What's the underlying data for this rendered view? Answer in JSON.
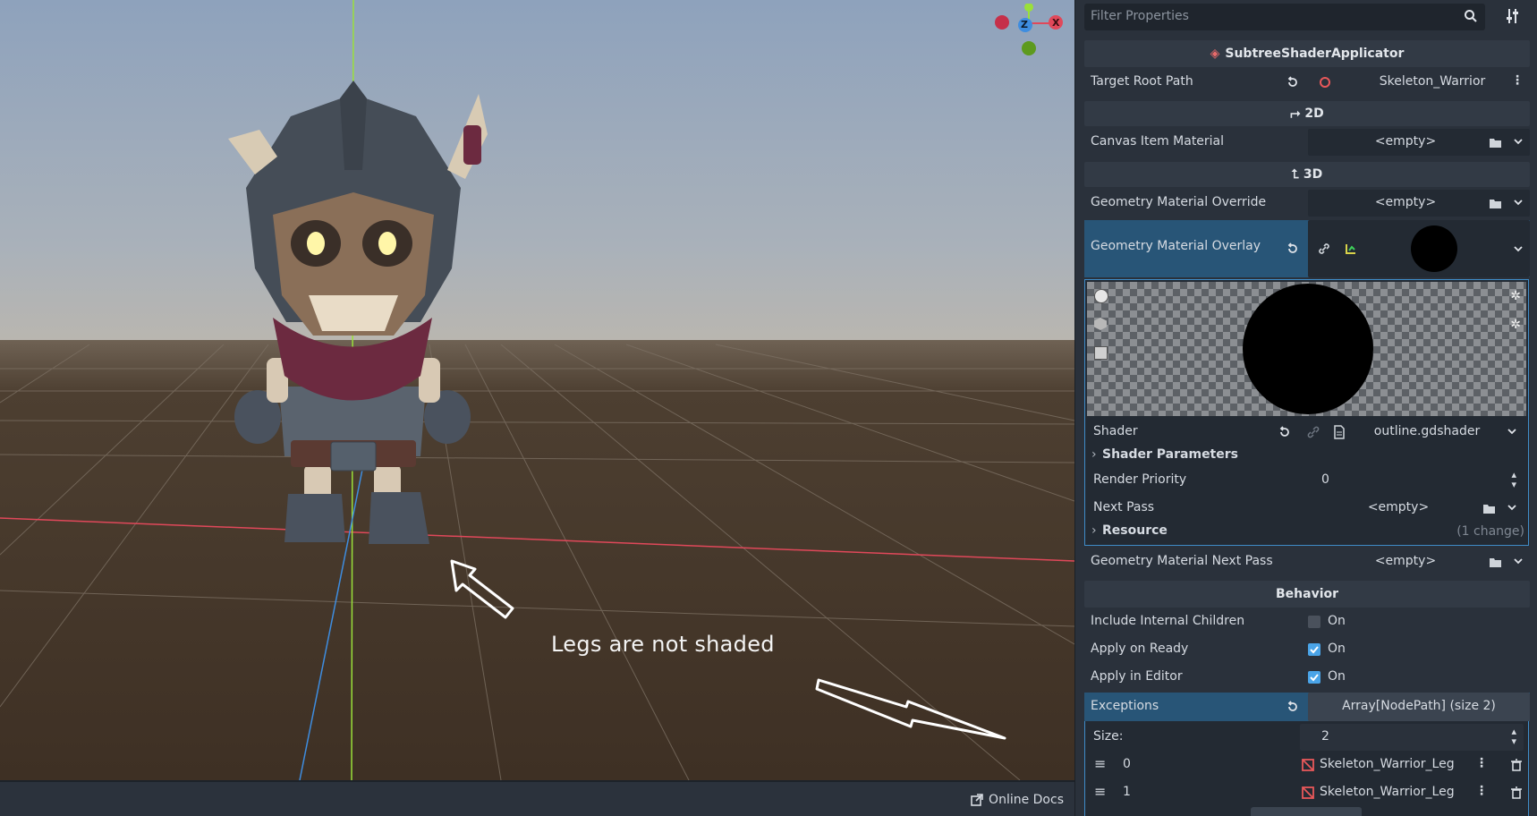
{
  "viewport": {
    "annotation": "Legs are not shaded",
    "gizmo": {
      "z_label": "Z",
      "x_label": "X"
    }
  },
  "bottom_bar": {
    "online_docs": "Online Docs"
  },
  "inspector": {
    "filter_placeholder": "Filter Properties",
    "node_section": "SubtreeShaderApplicator",
    "target_root_path": {
      "label": "Target Root Path",
      "value": "Skeleton_Warrior"
    },
    "section_2d": "2D",
    "canvas_item_material": {
      "label": "Canvas Item Material",
      "value": "<empty>"
    },
    "section_3d": "3D",
    "geometry_material_override": {
      "label": "Geometry Material Override",
      "value": "<empty>"
    },
    "geometry_material_overlay": {
      "label": "Geometry Material Overlay"
    },
    "shader": {
      "label": "Shader",
      "value": "outline.gdshader"
    },
    "shader_parameters": "Shader Parameters",
    "render_priority": {
      "label": "Render Priority",
      "value": "0"
    },
    "next_pass": {
      "label": "Next Pass",
      "value": "<empty>"
    },
    "resource": {
      "label": "Resource",
      "changes": "(1 change)"
    },
    "geometry_material_next_pass": {
      "label": "Geometry Material Next Pass",
      "value": "<empty>"
    },
    "section_behavior": "Behavior",
    "include_internal_children": {
      "label": "Include Internal Children",
      "value": "On",
      "checked": false
    },
    "apply_on_ready": {
      "label": "Apply on Ready",
      "value": "On",
      "checked": true
    },
    "apply_in_editor": {
      "label": "Apply in Editor",
      "value": "On",
      "checked": true
    },
    "exceptions": {
      "label": "Exceptions",
      "value": "Array[NodePath] (size 2)",
      "size_label": "Size:",
      "size_value": "2",
      "items": [
        {
          "index": "0",
          "value": "Skeleton_Warrior_Leg"
        },
        {
          "index": "1",
          "value": "Skeleton_Warrior_Leg"
        }
      ]
    }
  },
  "colors": {
    "selected_row": "#285577",
    "accent": "#4aa4e8",
    "axis_x": "#e0485a",
    "axis_y": "#9ae03a",
    "axis_z": "#3e8de0"
  }
}
